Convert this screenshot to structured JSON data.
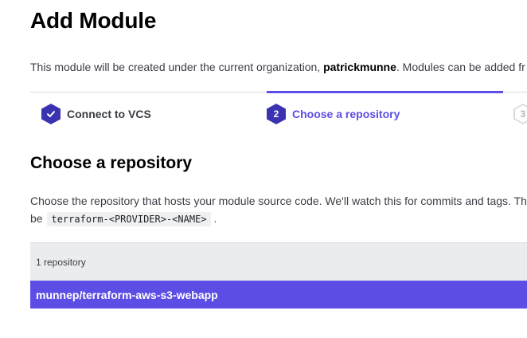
{
  "page": {
    "title": "Add Module",
    "intro_prefix": "This module will be created under the current organization, ",
    "organization": "patrickmunne",
    "intro_suffix": ". Modules can be added fr"
  },
  "steps": [
    {
      "number": "",
      "label": "Connect to VCS",
      "state": "complete",
      "icon": "check-icon"
    },
    {
      "number": "2",
      "label": "Choose a repository",
      "state": "active"
    },
    {
      "number": "3",
      "label": "",
      "state": "upcoming"
    }
  ],
  "section": {
    "title": "Choose a repository",
    "description_line1": "Choose the repository that hosts your module source code. We'll watch this for commits and tags. Th",
    "description_line2_prefix": "be",
    "naming_pattern": "terraform-<PROVIDER>-<NAME>",
    "description_line2_suffix": "."
  },
  "repositories": {
    "count_label": "1 repository",
    "items": [
      "munnep/terraform-aws-s3-webapp"
    ]
  },
  "colors": {
    "accent": "#5c4ee5",
    "accent_dark": "#3b32b2",
    "panel_bg": "#ebecee"
  }
}
